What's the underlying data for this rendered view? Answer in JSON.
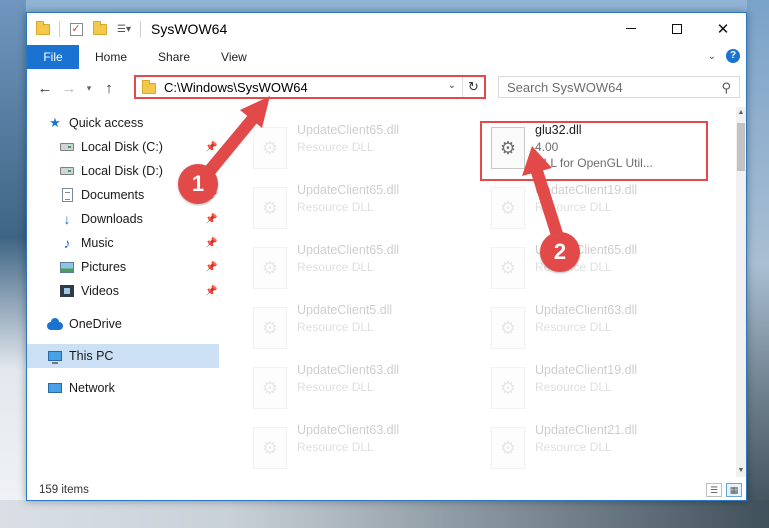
{
  "window": {
    "title": "SysWOW64"
  },
  "ribbon": {
    "tabs": [
      "File",
      "Home",
      "Share",
      "View"
    ],
    "help_label": "?"
  },
  "navigation": {
    "address_path": "C:\\Windows\\SysWOW64",
    "search_placeholder": "Search SysWOW64"
  },
  "sidebar": {
    "items": [
      {
        "label": "Quick access",
        "icon": "star-icon"
      },
      {
        "label": "Local Disk (C:)",
        "icon": "drive-icon",
        "pinned": true
      },
      {
        "label": "Local Disk (D:)",
        "icon": "drive-icon",
        "pinned": true
      },
      {
        "label": "Documents",
        "icon": "documents-icon",
        "pinned": true
      },
      {
        "label": "Downloads",
        "icon": "downloads-icon",
        "pinned": true
      },
      {
        "label": "Music",
        "icon": "music-icon",
        "pinned": true
      },
      {
        "label": "Pictures",
        "icon": "pictures-icon",
        "pinned": true
      },
      {
        "label": "Videos",
        "icon": "videos-icon",
        "pinned": true
      },
      {
        "label": "OneDrive",
        "icon": "onedrive-icon"
      },
      {
        "label": "This PC",
        "icon": "this-pc-icon",
        "selected": true
      },
      {
        "label": "Network",
        "icon": "network-icon"
      }
    ]
  },
  "files": {
    "highlighted": {
      "name": "glu32.dll",
      "version": "4.00",
      "description": "DLL for OpenGL Util..."
    },
    "faded_left": [
      {
        "name": "UpdateClient65.dll",
        "type": "Resource DLL"
      },
      {
        "name": "UpdateClient65.dll",
        "type": "Resource DLL"
      },
      {
        "name": "UpdateClient65.dll",
        "type": "Resource DLL"
      },
      {
        "name": "UpdateClient5.dll",
        "type": "Resource DLL"
      },
      {
        "name": "UpdateClient63.dll",
        "type": "Resource DLL"
      },
      {
        "name": "UpdateClient63.dll",
        "type": "Resource DLL"
      }
    ],
    "faded_right": [
      {
        "name": "UpdateClient19.dll",
        "type": "Resource DLL"
      },
      {
        "name": "UpdateClient65.dll",
        "type": "Resource DLL"
      },
      {
        "name": "UpdateClient63.dll",
        "type": "Resource DLL"
      },
      {
        "name": "UpdateClient19.dll",
        "type": "Resource DLL"
      },
      {
        "name": "UpdateClient21.dll",
        "type": "Resource DLL"
      }
    ]
  },
  "status": {
    "item_count": "159 items"
  },
  "annotations": {
    "marker1": "1",
    "marker2": "2",
    "color": "#e24a4a"
  }
}
